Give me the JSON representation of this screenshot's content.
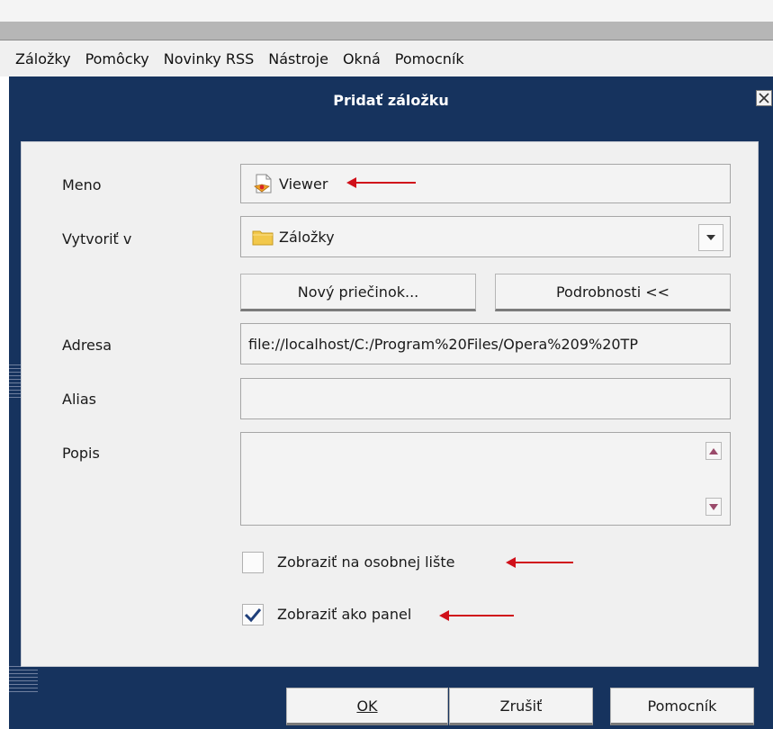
{
  "menubar": {
    "items": [
      "Záložky",
      "Pomôcky",
      "Novinky RSS",
      "Nástroje",
      "Okná",
      "Pomocník"
    ]
  },
  "dialog": {
    "title": "Pridať záložku",
    "fields": {
      "name_label": "Meno",
      "name_value": "Viewer",
      "create_in_label": "Vytvoriť v",
      "create_in_value": "Záložky",
      "address_label": "Adresa",
      "address_value": "file://localhost/C:/Program%20Files/Opera%209%20TP",
      "alias_label": "Alias",
      "alias_value": "",
      "description_label": "Popis",
      "description_value": ""
    },
    "buttons": {
      "new_folder": "Nový priečinok...",
      "details": "Podrobnosti <<",
      "ok": "OK",
      "cancel": "Zrušiť",
      "help": "Pomocník"
    },
    "checkboxes": {
      "show_on_personal_bar": {
        "label": "Zobraziť na osobnej lište",
        "checked": false
      },
      "show_as_panel": {
        "label": "Zobraziť ako panel",
        "checked": true
      }
    }
  },
  "colors": {
    "dialog_frame": "#16335e",
    "annotation_arrow": "#d0101a",
    "folder_icon": "#f2c84b"
  },
  "icons": [
    "bookmark-page-icon",
    "folder-icon",
    "chevron-down-icon",
    "arrow-up-icon",
    "arrow-down-icon",
    "checkmark-icon",
    "close-icon",
    "annotation-arrow"
  ]
}
